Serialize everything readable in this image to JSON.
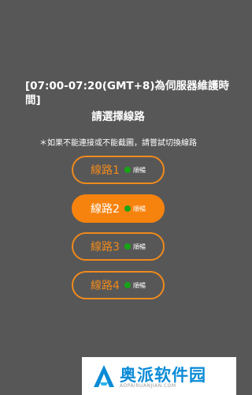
{
  "notice": "[07:00-07:20(GMT+8)為伺服器維護時間]",
  "title": "請選擇線路",
  "hint": "＊如果不能連接或不能截圖，請嘗試切換線路",
  "lines": [
    {
      "label": "線路1",
      "status": "順暢",
      "selected": false
    },
    {
      "label": "線路2",
      "status": "順暢",
      "selected": true
    },
    {
      "label": "線路3",
      "status": "順暢",
      "selected": false
    },
    {
      "label": "線路4",
      "status": "順暢",
      "selected": false
    }
  ],
  "colors": {
    "background": "#575757",
    "accent": "#f7830f",
    "status_ok": "#17a417",
    "watermark_blue": "#0b8bd6"
  },
  "watermark": {
    "text": "奥派软件园",
    "sub": "AOPAIRUANJIAN.COM",
    "logo_icon": "triangle-a-logo"
  }
}
